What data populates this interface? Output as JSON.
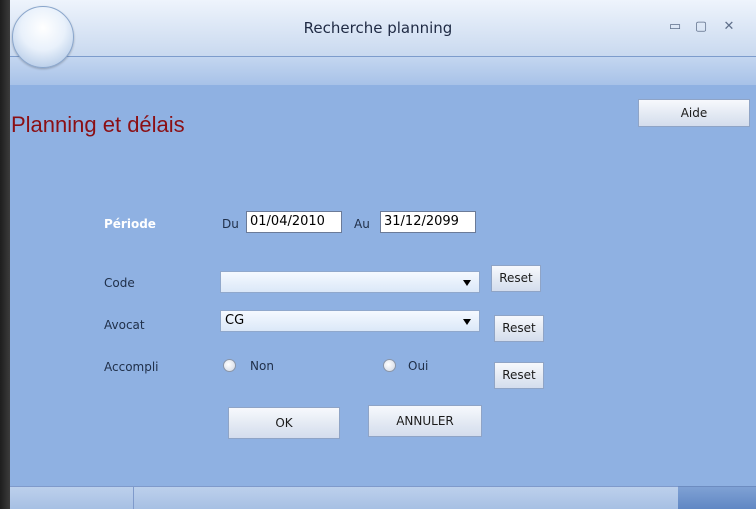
{
  "window": {
    "title": "Recherche planning",
    "controls": {
      "minimize": "▭",
      "maximize": "▢",
      "close": "✕"
    }
  },
  "toolbar": {
    "help_label": "Aide"
  },
  "page": {
    "heading": "Planning et délais"
  },
  "form": {
    "period": {
      "label": "Période",
      "from_label": "Du",
      "from_value": "01/04/2010",
      "to_label": "Au",
      "to_value": "31/12/2099"
    },
    "code": {
      "label": "Code",
      "value": "",
      "reset_label": "Reset"
    },
    "avocat": {
      "label": "Avocat",
      "value": "CG",
      "reset_label": "Reset"
    },
    "accompli": {
      "label": "Accompli",
      "option_no": "Non",
      "option_yes": "Oui",
      "reset_label": "Reset"
    }
  },
  "actions": {
    "ok_label": "OK",
    "cancel_label": "ANNULER"
  },
  "colors": {
    "background": "#8fb1e2",
    "heading": "#8b0f14",
    "period_label": "#ffffff"
  }
}
